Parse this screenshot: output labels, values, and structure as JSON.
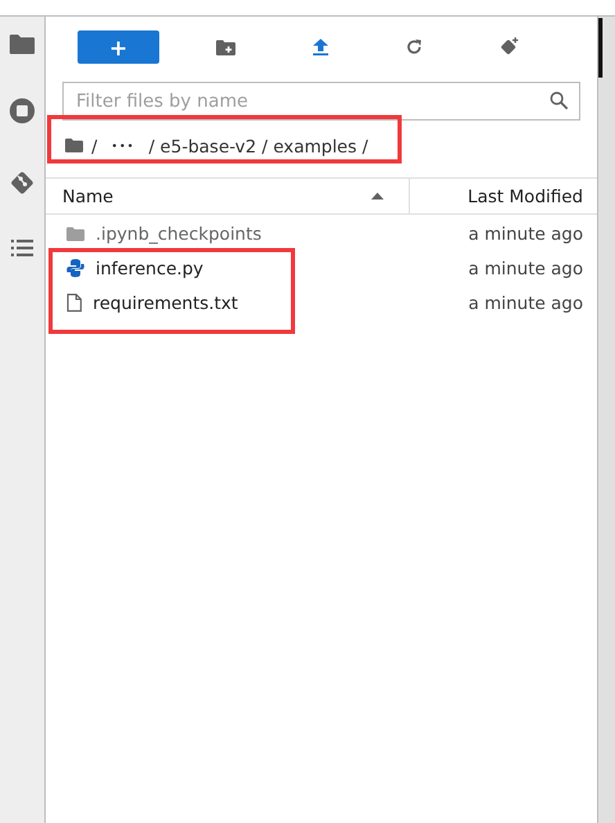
{
  "toolbar": {
    "new_button": "+"
  },
  "search": {
    "placeholder": "Filter files by name"
  },
  "breadcrumb": {
    "parts": [
      "/",
      "•••",
      "/ e5-base-v2 / examples /"
    ],
    "highlighted": true
  },
  "table": {
    "columns": [
      {
        "label": "Name",
        "sorted": true
      },
      {
        "label": "Last Modified",
        "sorted": false
      }
    ],
    "rows": [
      {
        "kind": "folder",
        "name": ".ipynb_checkpoints",
        "modified": "a minute ago",
        "highlighted": false
      },
      {
        "kind": "python",
        "name": "inference.py",
        "modified": "a minute ago",
        "highlighted": true
      },
      {
        "kind": "text",
        "name": "requirements.txt",
        "modified": "a minute ago",
        "highlighted": true
      }
    ]
  }
}
